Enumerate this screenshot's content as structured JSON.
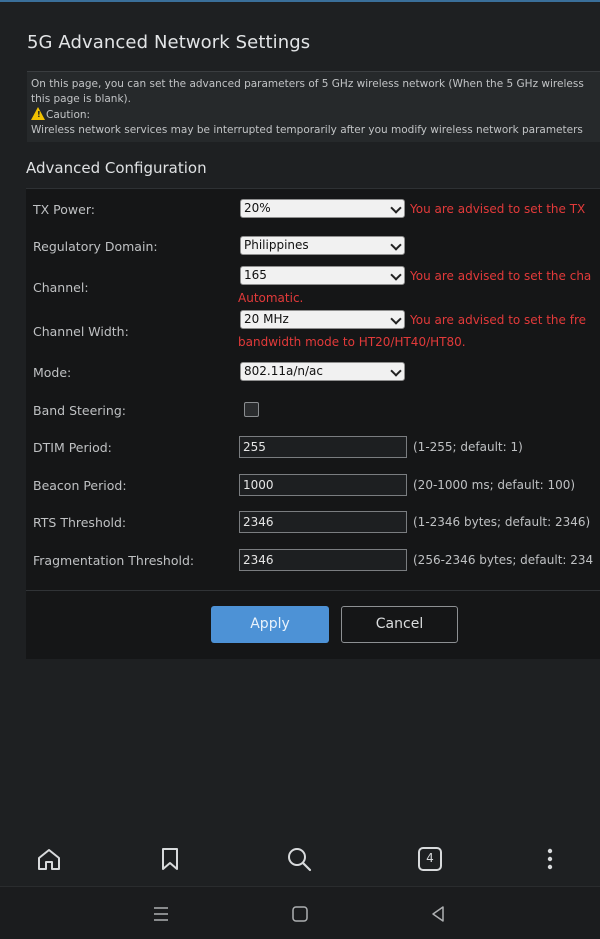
{
  "page": {
    "title": "5G Advanced Network Settings",
    "description_line1": "On this page, you can set the advanced parameters of 5 GHz wireless network (When the 5 GHz wireless",
    "description_line2": "this page is blank).",
    "caution_label": "Caution:",
    "caution_text": "Wireless network services may be interrupted temporarily after you modify wireless network parameters"
  },
  "config": {
    "section_title": "Advanced Configuration",
    "tx_power": {
      "label": "TX Power:",
      "value": "20%",
      "hint": "You are advised to set the TX"
    },
    "regulatory_domain": {
      "label": "Regulatory Domain:",
      "value": "Philippines"
    },
    "channel": {
      "label": "Channel:",
      "value": "165",
      "hint_line1": "You are advised to set the cha",
      "hint_line2": "Automatic."
    },
    "channel_width": {
      "label": "Channel Width:",
      "value": "20 MHz",
      "hint_line1": "You are advised to set the fre",
      "hint_line2": "bandwidth mode to HT20/HT40/HT80."
    },
    "mode": {
      "label": "Mode:",
      "value": "802.11a/n/ac"
    },
    "band_steering": {
      "label": "Band Steering:",
      "checked": false
    },
    "dtim_period": {
      "label": "DTIM Period:",
      "value": "255",
      "note": "(1-255; default: 1)"
    },
    "beacon_period": {
      "label": "Beacon Period:",
      "value": "1000",
      "note": "(20-1000 ms; default: 100)"
    },
    "rts_threshold": {
      "label": "RTS Threshold:",
      "value": "2346",
      "note": "(1-2346 bytes; default: 2346)"
    },
    "fragmentation_threshold": {
      "label": "Fragmentation Threshold:",
      "value": "2346",
      "note": "(256-2346 bytes; default: 234"
    }
  },
  "actions": {
    "apply_label": "Apply",
    "cancel_label": "Cancel"
  },
  "browser_bar": {
    "tab_count": "4",
    "icons": [
      "home-icon",
      "bookmark-icon",
      "search-icon",
      "tabs-icon",
      "more-vertical-icon"
    ]
  },
  "system_bar": {
    "icons": [
      "recents-icon",
      "home-circle-icon",
      "back-icon"
    ]
  },
  "colors": {
    "accent": "#4d92d6",
    "hint_red": "#e23a3a",
    "caution_yellow": "#f2c200",
    "background": "#1e2022"
  }
}
